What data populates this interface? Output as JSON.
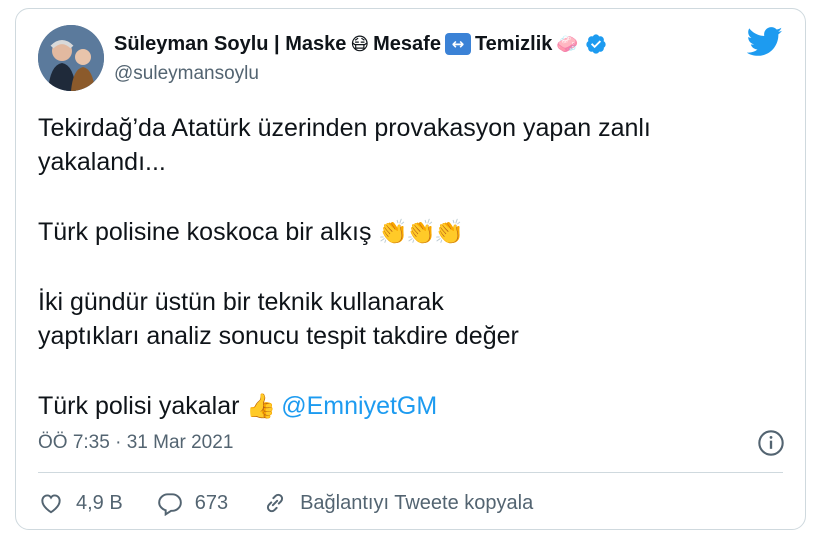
{
  "author": {
    "display_name": "Süleyman Soylu | Maske",
    "name_part_mesafe": "Mesafe",
    "name_part_temizlik": "Temizlik",
    "emoji_mask": "😷",
    "emoji_arrows": "↔",
    "emoji_soap": "🧼",
    "handle": "@suleymansoylu"
  },
  "tweet": {
    "line1": "Tekirdağ’da Atatürk üzerinden provakasyon yapan  zanlı",
    "line2": "yakalandı...",
    "line3_text": "Türk polisine koskoca bir alkış ",
    "line3_emoji": "👏👏👏",
    "line4": "İki gündür üstün bir teknik kullanarak",
    "line5": "yaptıkları analiz sonucu tespit takdire değer",
    "line6_text": "Türk polisi yakalar ",
    "line6_emoji": "👍",
    "mention": "@EmniyetGM"
  },
  "timestamp": "ÖÖ 7:35 · 31 Mar 2021",
  "actions": {
    "like_count": "4,9 B",
    "reply_count": "673",
    "copy_link_label": "Bağlantıyı Tweete kopyala"
  },
  "colors": {
    "brand": "#1d9bf0",
    "text": "#0f1419",
    "muted": "#536471",
    "border": "#cfd9de"
  },
  "icons": [
    "twitter-bird-icon",
    "verified-badge-icon",
    "info-icon",
    "heart-icon",
    "reply-icon",
    "link-icon"
  ]
}
